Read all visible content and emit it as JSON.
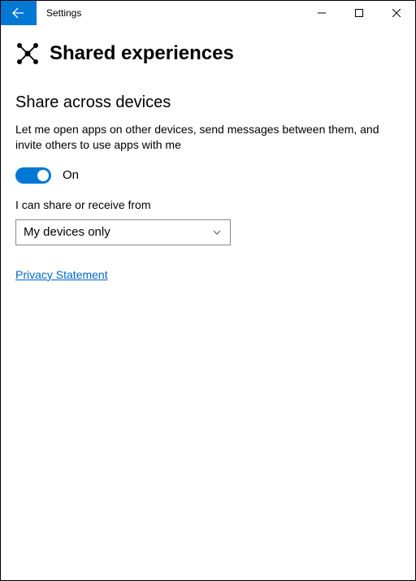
{
  "window": {
    "title": "Settings"
  },
  "page": {
    "title": "Shared experiences"
  },
  "section": {
    "title": "Share across devices",
    "description": "Let me open apps on other devices, send messages between them, and invite others to use apps with me",
    "toggle_state": "On",
    "share_label": "I can share or receive from",
    "dropdown_value": "My devices only"
  },
  "links": {
    "privacy": "Privacy Statement"
  }
}
